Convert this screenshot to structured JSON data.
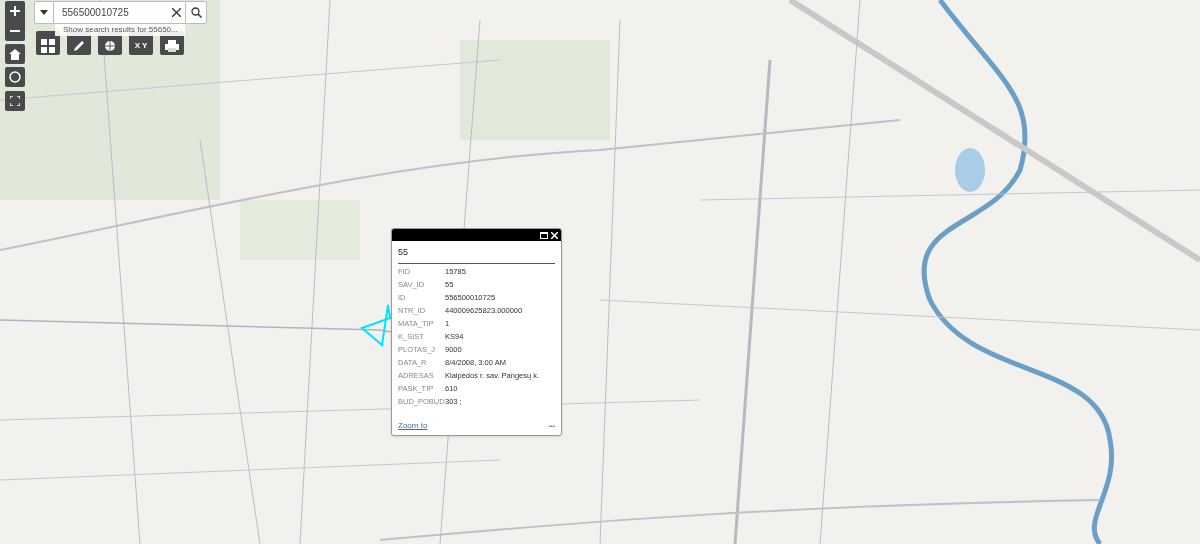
{
  "search": {
    "value": "556500010725",
    "suggestion": "Show search results for 55650..."
  },
  "tools": [
    {
      "kind": "grid"
    },
    {
      "kind": "pencil"
    },
    {
      "kind": "globe"
    },
    {
      "kind": "xy",
      "label": "X Y"
    },
    {
      "kind": "print"
    }
  ],
  "popup": {
    "title": "55",
    "fields": [
      {
        "name": "FID",
        "value": "15785"
      },
      {
        "name": "SAV_ID",
        "value": "55"
      },
      {
        "name": "ID",
        "value": "556500010725"
      },
      {
        "name": "NTR_ID",
        "value": "440009625823.000000"
      },
      {
        "name": "MATA_TIP",
        "value": "1"
      },
      {
        "name": "K_SIST",
        "value": "KS94"
      },
      {
        "name": "PLOTAS_J",
        "value": "9000"
      },
      {
        "name": "DATA_R",
        "value": "8/4/2008, 3:00 AM"
      },
      {
        "name": "ADRESAS",
        "value": "Klaipėdos r. sav. Pangesų k."
      },
      {
        "name": "PASK_TIP",
        "value": "610"
      },
      {
        "name": "BUD_POBUD",
        "value": "303 ;"
      }
    ],
    "link": "Zoom to",
    "more": "•••"
  }
}
